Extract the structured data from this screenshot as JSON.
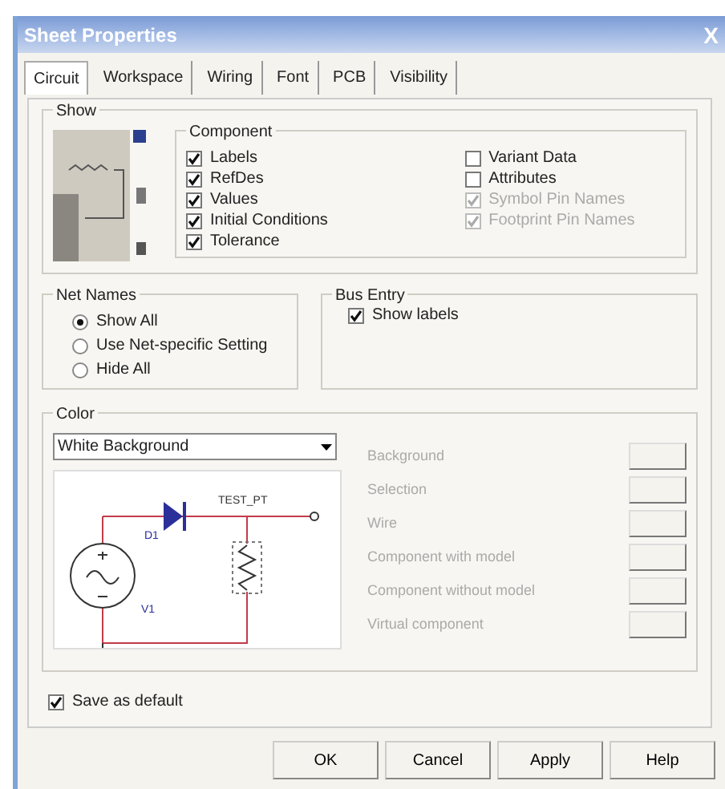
{
  "window": {
    "title": "Sheet Properties",
    "close": "X"
  },
  "tabs": [
    {
      "label": "Circuit",
      "selected": true
    },
    {
      "label": "Workspace",
      "selected": false
    },
    {
      "label": "Wiring",
      "selected": false
    },
    {
      "label": "Font",
      "selected": false
    },
    {
      "label": "PCB",
      "selected": false
    },
    {
      "label": "Visibility",
      "selected": false
    }
  ],
  "show": {
    "title": "Show",
    "component": {
      "title": "Component",
      "options": [
        {
          "label": "Labels",
          "checked": true,
          "disabled": false
        },
        {
          "label": "RefDes",
          "checked": true,
          "disabled": false
        },
        {
          "label": "Values",
          "checked": true,
          "disabled": false
        },
        {
          "label": "Initial Conditions",
          "checked": true,
          "disabled": false
        },
        {
          "label": "Tolerance",
          "checked": true,
          "disabled": false
        },
        {
          "label": "Variant Data",
          "checked": false,
          "disabled": false
        },
        {
          "label": "Attributes",
          "checked": false,
          "disabled": false
        },
        {
          "label": "Symbol Pin Names",
          "checked": true,
          "disabled": true
        },
        {
          "label": "Footprint Pin Names",
          "checked": true,
          "disabled": true
        }
      ]
    }
  },
  "net_names": {
    "title": "Net Names",
    "options": [
      {
        "label": "Show All",
        "selected": true
      },
      {
        "label": "Use Net-specific Setting",
        "selected": false
      },
      {
        "label": "Hide All",
        "selected": false
      }
    ]
  },
  "bus_entry": {
    "title": "Bus Entry",
    "options": [
      {
        "label": "Show labels",
        "checked": true
      }
    ]
  },
  "color": {
    "title": "Color",
    "scheme": "White Background",
    "preview_labels": [
      "TEST_PT",
      "D1",
      "V1"
    ],
    "items": [
      {
        "label": "Background",
        "disabled": true
      },
      {
        "label": "Selection",
        "disabled": true
      },
      {
        "label": "Wire",
        "disabled": true
      },
      {
        "label": "Component with model",
        "disabled": true
      },
      {
        "label": "Component without model",
        "disabled": true
      },
      {
        "label": "Virtual component",
        "disabled": true
      }
    ]
  },
  "save_default": {
    "label": "Save as default",
    "checked": true
  },
  "buttons": [
    "OK",
    "Cancel",
    "Apply",
    "Help"
  ]
}
